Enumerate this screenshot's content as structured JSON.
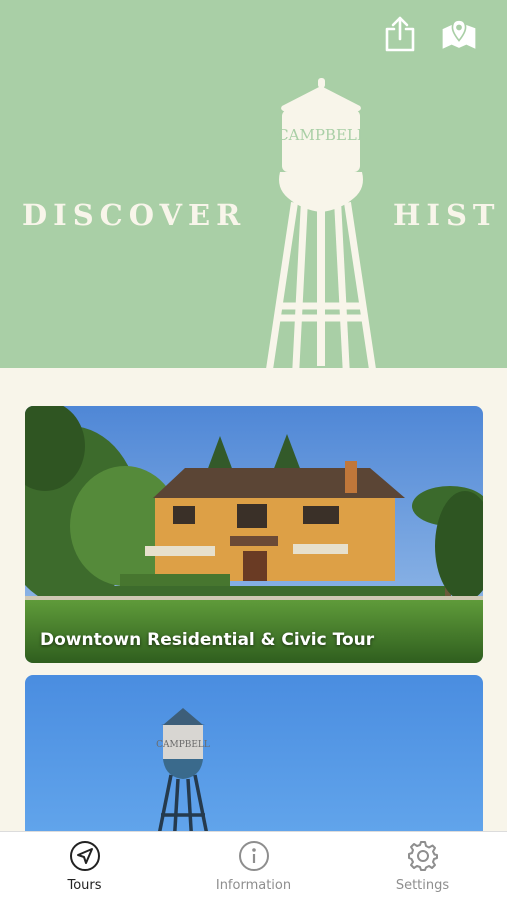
{
  "hero": {
    "word_left": "DISCOVER",
    "word_right": "HIST",
    "tower_text": "CAMPBELL",
    "background": "#a9cfa6",
    "foreground": "#f8f5ea",
    "share_icon": "share-icon",
    "map_icon": "map-pin-icon"
  },
  "tours": [
    {
      "title": "Downtown Residential & Civic Tour"
    },
    {
      "title": "",
      "photo_text": "CAMPBELL"
    }
  ],
  "tabbar": {
    "tabs": [
      {
        "label": "Tours",
        "icon": "navigation-arrow-icon",
        "active": true
      },
      {
        "label": "Information",
        "icon": "info-icon",
        "active": false
      },
      {
        "label": "Settings",
        "icon": "gear-icon",
        "active": false
      }
    ]
  }
}
